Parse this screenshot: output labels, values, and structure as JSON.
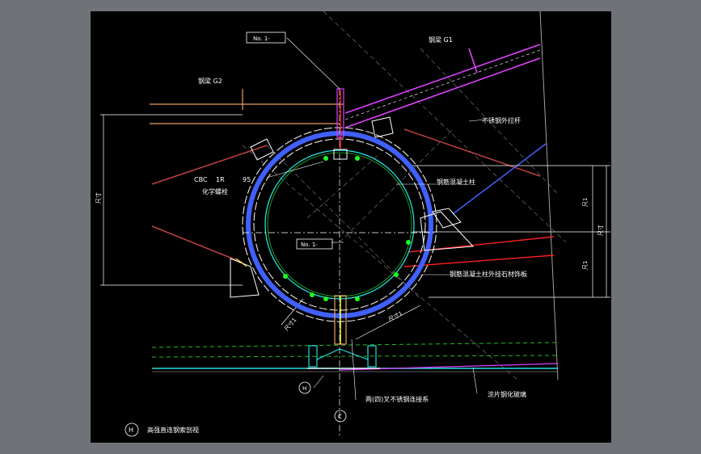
{
  "drawing": {
    "tag_top": "No. 1-",
    "tag_mid": "No. 1-",
    "beam_g1": "钢梁 G1",
    "beam_g2": "钢梁 G2",
    "stainless_rod": "不锈钢外拉杆",
    "cbc_code": "CBC",
    "cbc_num1": "1R",
    "cbc_num2": "95",
    "chem_bolt": "化学螺栓",
    "steel_concrete_col": "钢筋混凝土柱",
    "stone_cladding": "钢筋混凝土柱外挂石材饰板",
    "dim_l1": "尺寸1",
    "dim_l2": "尺寸1",
    "dim_r1": "尺1",
    "dim_r2": "尺寸",
    "dim_r3": "尺1",
    "dim_left": "尺寸",
    "grid_h": "H",
    "grid_c": "C",
    "connector_note": "两(四)叉不锈钢连接系",
    "glass_note": "涂片钢化玻璃",
    "footer_grid": "H",
    "footer_title": "高强直连钢索剖视"
  },
  "colors": {
    "background": "#000000",
    "frame": "#6f7377",
    "beam_magenta": "#e040ff",
    "beam_orange": "#e8a060",
    "ring_blue": "#4060ff",
    "ring_white": "#ffffff",
    "ring_cyan": "#20e0e0",
    "red_line": "#ff2020",
    "green_dash": "#20c020",
    "yellow": "#ffff40"
  }
}
